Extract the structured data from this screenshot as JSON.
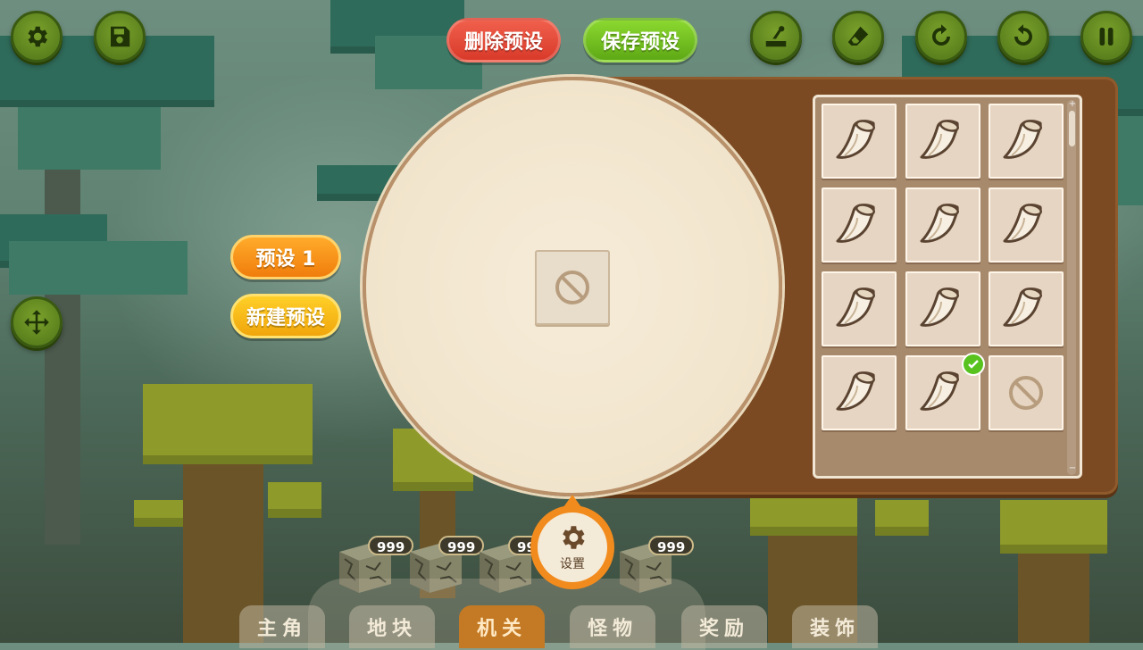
{
  "top_buttons": {
    "delete_preset": "删除预设",
    "save_preset": "保存预设"
  },
  "side_buttons": {
    "preset_1": "预设 1",
    "new_preset": "新建预设"
  },
  "toolbar_icons": [
    "gear-icon",
    "save-icon",
    "lever-icon",
    "eraser-icon",
    "redo-icon",
    "undo-icon",
    "pause-icon"
  ],
  "left_icon": "move-icon",
  "preview": {
    "center_item": "empty-slot-icon"
  },
  "item_grid": {
    "items": [
      {
        "icon": "horn-icon",
        "selected": false
      },
      {
        "icon": "horn-icon",
        "selected": false
      },
      {
        "icon": "horn-icon",
        "selected": false
      },
      {
        "icon": "horn-icon",
        "selected": false
      },
      {
        "icon": "horn-icon",
        "selected": false
      },
      {
        "icon": "horn-icon",
        "selected": false
      },
      {
        "icon": "horn-icon",
        "selected": false
      },
      {
        "icon": "horn-icon",
        "selected": false
      },
      {
        "icon": "horn-icon",
        "selected": false
      },
      {
        "icon": "horn-icon",
        "selected": false
      },
      {
        "icon": "horn-icon",
        "selected": true
      },
      {
        "icon": "empty-slot-icon",
        "selected": false
      }
    ]
  },
  "settings": {
    "label": "设置"
  },
  "hotbar": {
    "counts": [
      "999",
      "999",
      "999",
      "999"
    ]
  },
  "tabs": [
    {
      "label": "主角",
      "active": false
    },
    {
      "label": "地块",
      "active": false
    },
    {
      "label": "机关",
      "active": true
    },
    {
      "label": "怪物",
      "active": false
    },
    {
      "label": "奖励",
      "active": false
    },
    {
      "label": "装饰",
      "active": false
    }
  ],
  "colors": {
    "panel": "#7c4a22",
    "accent_orange": "#f28b1d",
    "button_green": "#5ea915",
    "button_red": "#d93a2a"
  }
}
